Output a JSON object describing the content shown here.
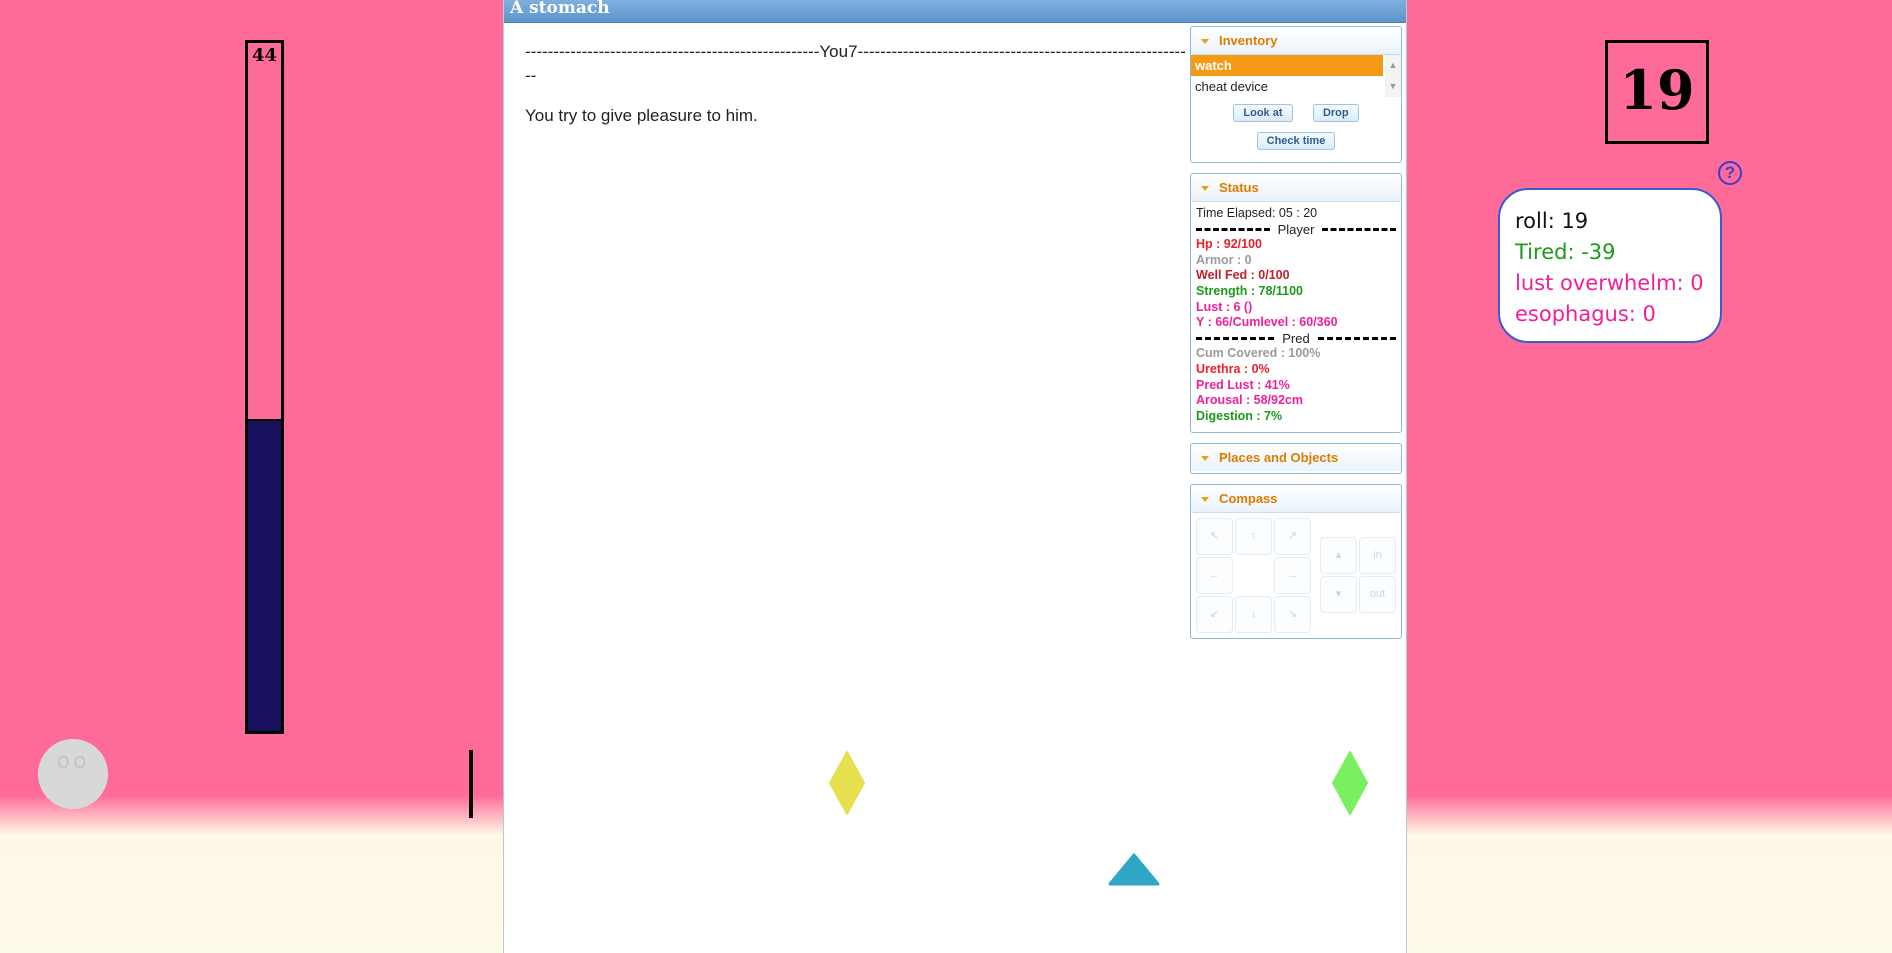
{
  "meter": {
    "value": 44,
    "fill_percent": 45
  },
  "main": {
    "title": "A stomach",
    "divider": "----------------------------------------------------You7------------------------------------------------------------",
    "story_line": "You try to give pleasure to him."
  },
  "inventory": {
    "header": "Inventory",
    "items": [
      "watch",
      "cheat device"
    ],
    "selected": "watch",
    "buttons": {
      "look": "Look at",
      "drop": "Drop",
      "check_time": "Check time"
    }
  },
  "status": {
    "header": "Status",
    "time_elapsed": "Time Elapsed: 05 : 20",
    "player_label": "Player",
    "hp": "Hp : 92/100",
    "armor": "Armor : 0",
    "well_fed": "Well Fed : 0/100",
    "strength": "Strength : 78/1100",
    "lust": "Lust : 6 ()",
    "y": "Y : 66/Cumlevel : 60/360",
    "pred_label": "Pred",
    "cum_covered": "Cum Covered : 100%",
    "urethra": "Urethra : 0%",
    "pred_lust": "Pred Lust : 41%",
    "arousal": "Arousal : 58/92cm",
    "digestion": "Digestion : 7%"
  },
  "places": {
    "header": "Places and Objects"
  },
  "compass": {
    "header": "Compass",
    "nw": "↖",
    "n": "↑",
    "ne": "↗",
    "w": "←",
    "e": "→",
    "sw": "↙",
    "s": "↓",
    "se": "↘",
    "up": "▴",
    "down": "▾",
    "in": "in",
    "out": "out"
  },
  "roll_box": {
    "value": "19"
  },
  "help": {
    "label": "?"
  },
  "roll_info": {
    "roll": "roll: 19",
    "tired": "Tired: -39",
    "lust_overwhelm": "lust overwhelm: 0",
    "esophagus": "esophagus: 0"
  },
  "colors": {
    "background": "#ff6b98",
    "meter_fill": "#1a1060",
    "diamond_yellow": "#e6e050",
    "diamond_green": "#7af060",
    "triangle_teal": "#2ea6c4"
  }
}
